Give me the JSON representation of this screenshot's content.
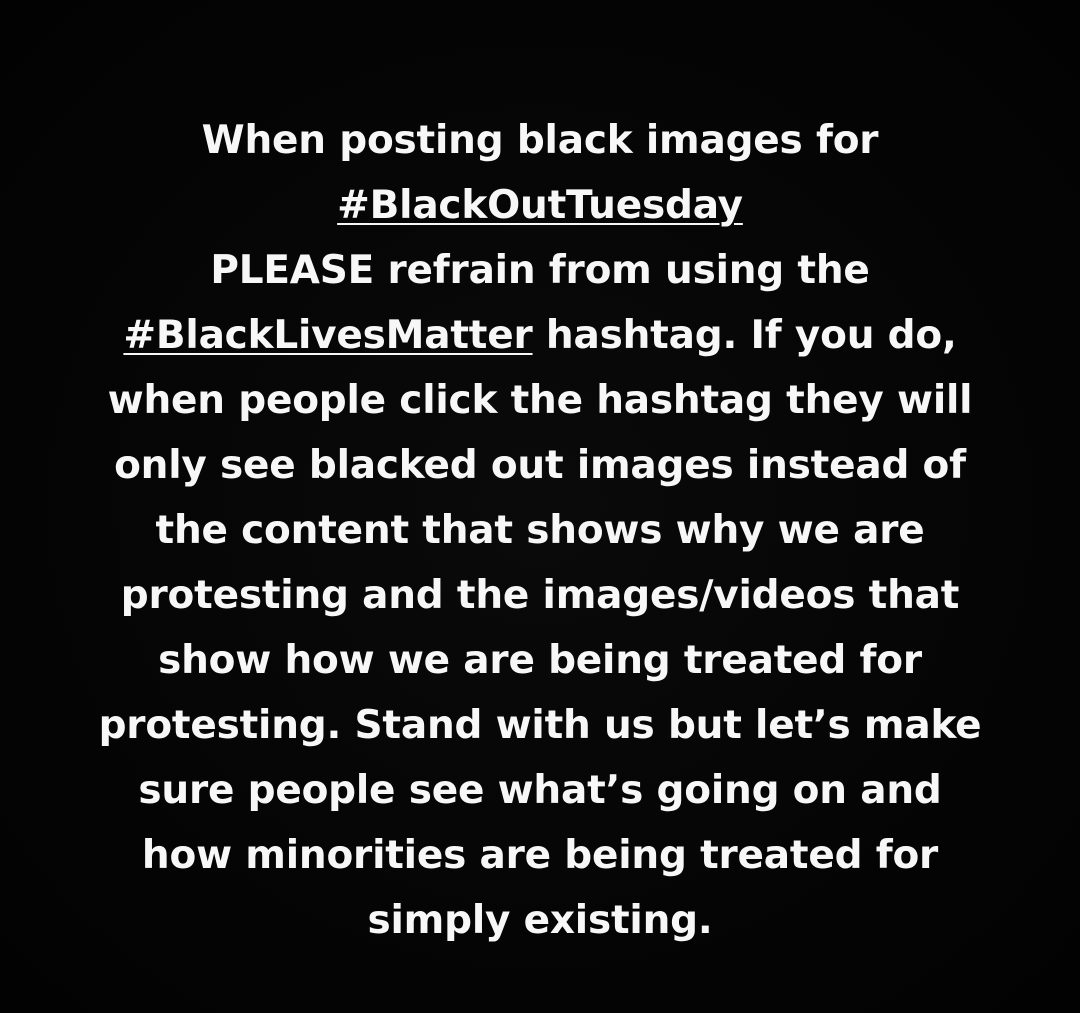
{
  "post": {
    "background": "#000000",
    "text_color": "#f7f7f7",
    "lines": [
      {
        "pre": "When posting black images for",
        "tag": "",
        "post": ""
      },
      {
        "pre": "",
        "tag": "#BlackOutTuesday",
        "post": ""
      },
      {
        "pre": "PLEASE refrain from using the",
        "tag": "",
        "post": ""
      },
      {
        "pre": "",
        "tag": "#BlackLivesMatter",
        "post": " hashtag. If you do,"
      },
      {
        "pre": "when people click the hashtag they will",
        "tag": "",
        "post": ""
      },
      {
        "pre": "only see blacked out images instead of",
        "tag": "",
        "post": ""
      },
      {
        "pre": "the content that shows why we are",
        "tag": "",
        "post": ""
      },
      {
        "pre": "protesting and the images/videos that",
        "tag": "",
        "post": ""
      },
      {
        "pre": "show how we are being treated for",
        "tag": "",
        "post": ""
      },
      {
        "pre": "protesting. Stand with us but let’s make",
        "tag": "",
        "post": ""
      },
      {
        "pre": "sure people see what’s going on and",
        "tag": "",
        "post": ""
      },
      {
        "pre": "how minorities are being treated for",
        "tag": "",
        "post": ""
      },
      {
        "pre": "simply existing.",
        "tag": "",
        "post": ""
      }
    ]
  }
}
